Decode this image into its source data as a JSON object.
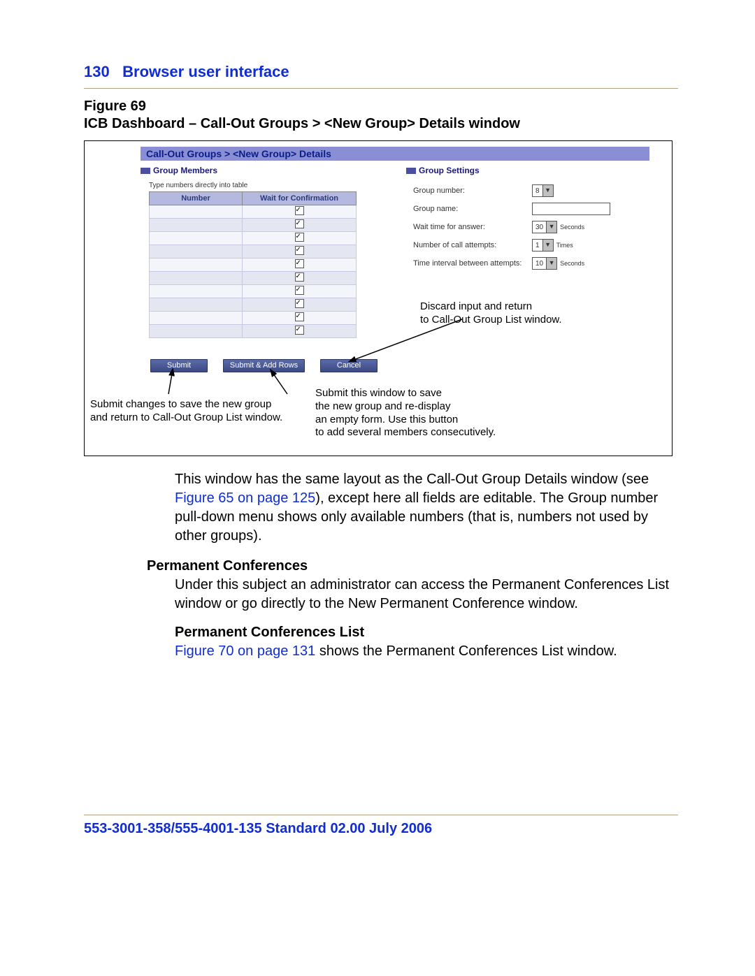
{
  "header": {
    "page_number": "130",
    "title": "Browser user interface"
  },
  "figure": {
    "label": "Figure 69",
    "title": "ICB Dashboard – Call-Out Groups > <New Group> Details window",
    "breadcrumb": "Call-Out Groups > <New Group> Details",
    "group_members_heading": "Group Members",
    "group_settings_heading": "Group Settings",
    "type_hint": "Type numbers directly into table",
    "table_headers": {
      "number": "Number",
      "wait": "Wait for Confirmation"
    },
    "row_count": 10,
    "settings": {
      "group_number": {
        "label": "Group number:",
        "value": "8"
      },
      "group_name": {
        "label": "Group name:"
      },
      "wait_time": {
        "label": "Wait time for answer:",
        "value": "30",
        "unit": "Seconds"
      },
      "attempts": {
        "label": "Number of call attempts:",
        "value": "1",
        "unit": "Times"
      },
      "interval": {
        "label": "Time interval between attempts:",
        "value": "10",
        "unit": "Seconds"
      }
    },
    "buttons": {
      "submit": "Submit",
      "submit_add": "Submit & Add Rows",
      "cancel": "Cancel"
    },
    "annotations": {
      "cancel_note_l1": "Discard input and return",
      "cancel_note_l2": "to Call-Out Group List window.",
      "submit_note_l1": "Submit changes to save the new group",
      "submit_note_l2": "and return to Call-Out Group List window.",
      "addrows_note_l1": "Submit this window to save",
      "addrows_note_l2": "the new group and re-display",
      "addrows_note_l3": "an empty form. Use this button",
      "addrows_note_l4": "to add several members consecutively."
    }
  },
  "paragraphs": {
    "p1a": "This window has the same layout as the Call-Out Group Details window (see ",
    "p1_xref": "Figure 65 on page 125",
    "p1b": "), except here all fields are editable. The Group number pull-down menu shows only available numbers (that is, numbers not used by other groups).",
    "sub1": "Permanent Conferences",
    "p2": "Under this subject an administrator can access the Permanent Conferences List window or go directly to the New Permanent Conference window.",
    "sub2": "Permanent Conferences List",
    "p3_xref": "Figure 70 on page 131",
    "p3b": " shows the Permanent Conferences List window."
  },
  "footer": {
    "text": "553-3001-358/555-4001-135   Standard   02.00   July 2006"
  }
}
